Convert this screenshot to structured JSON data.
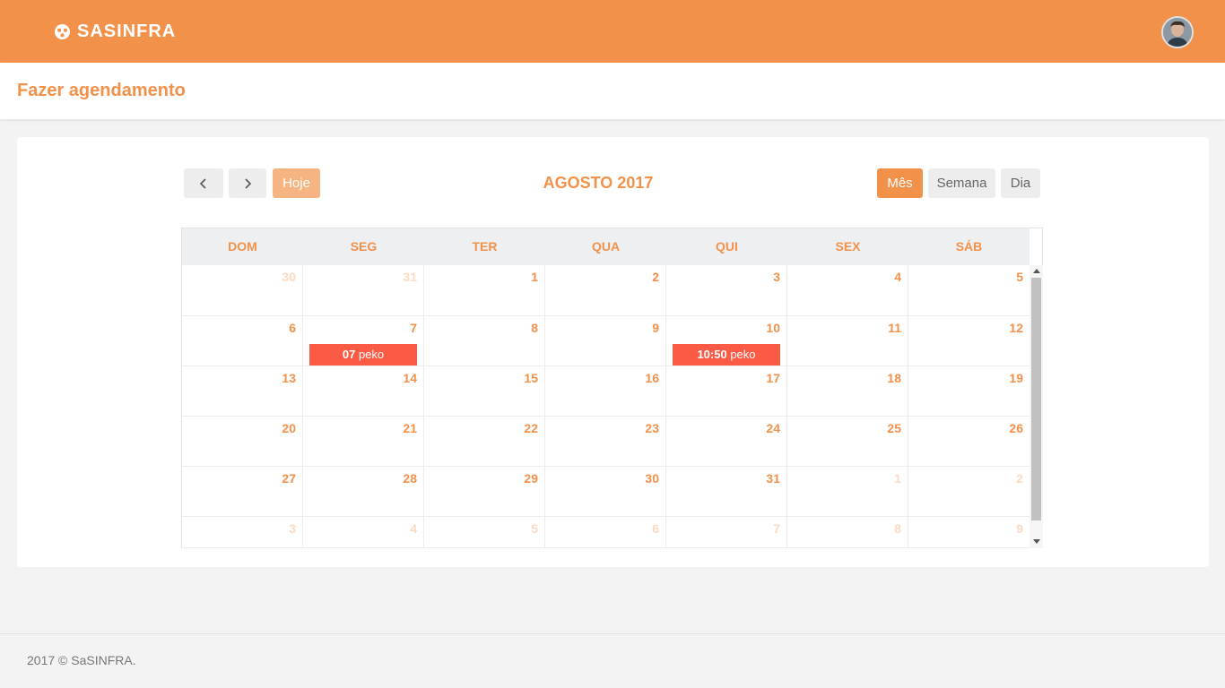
{
  "app": {
    "brand": "SASINFRA",
    "brand_icon": "circle-logo-icon"
  },
  "header": {
    "avatar_icon": "user-avatar"
  },
  "page": {
    "title": "Fazer agendamento"
  },
  "calendar": {
    "title": "AGOSTO 2017",
    "today_label": "Hoje",
    "views": {
      "month": "Mês",
      "week": "Semana",
      "day": "Dia"
    },
    "active_view": "month",
    "day_names": [
      "DOM",
      "SEG",
      "TER",
      "QUA",
      "QUI",
      "SEX",
      "SÁB"
    ],
    "weeks": [
      [
        {
          "d": "30",
          "o": true
        },
        {
          "d": "31",
          "o": true
        },
        {
          "d": "1"
        },
        {
          "d": "2"
        },
        {
          "d": "3"
        },
        {
          "d": "4"
        },
        {
          "d": "5"
        }
      ],
      [
        {
          "d": "6"
        },
        {
          "d": "7",
          "ev": {
            "time": "07",
            "title": "peko"
          }
        },
        {
          "d": "8"
        },
        {
          "d": "9"
        },
        {
          "d": "10",
          "ev": {
            "time": "10:50",
            "title": "peko"
          }
        },
        {
          "d": "11"
        },
        {
          "d": "12"
        }
      ],
      [
        {
          "d": "13"
        },
        {
          "d": "14"
        },
        {
          "d": "15"
        },
        {
          "d": "16"
        },
        {
          "d": "17"
        },
        {
          "d": "18"
        },
        {
          "d": "19"
        }
      ],
      [
        {
          "d": "20"
        },
        {
          "d": "21"
        },
        {
          "d": "22"
        },
        {
          "d": "23"
        },
        {
          "d": "24"
        },
        {
          "d": "25"
        },
        {
          "d": "26"
        }
      ],
      [
        {
          "d": "27"
        },
        {
          "d": "28"
        },
        {
          "d": "29"
        },
        {
          "d": "30"
        },
        {
          "d": "31"
        },
        {
          "d": "1",
          "o": true
        },
        {
          "d": "2",
          "o": true
        }
      ],
      [
        {
          "d": "3",
          "o": true
        },
        {
          "d": "4",
          "o": true
        },
        {
          "d": "5",
          "o": true
        },
        {
          "d": "6",
          "o": true
        },
        {
          "d": "7",
          "o": true
        },
        {
          "d": "8",
          "o": true
        },
        {
          "d": "9",
          "o": true
        }
      ]
    ]
  },
  "footer": {
    "text": "2017 © SaSINFRA."
  },
  "colors": {
    "accent": "#f2914a",
    "event": "#fb5a45",
    "accent_light": "#f6b482"
  }
}
